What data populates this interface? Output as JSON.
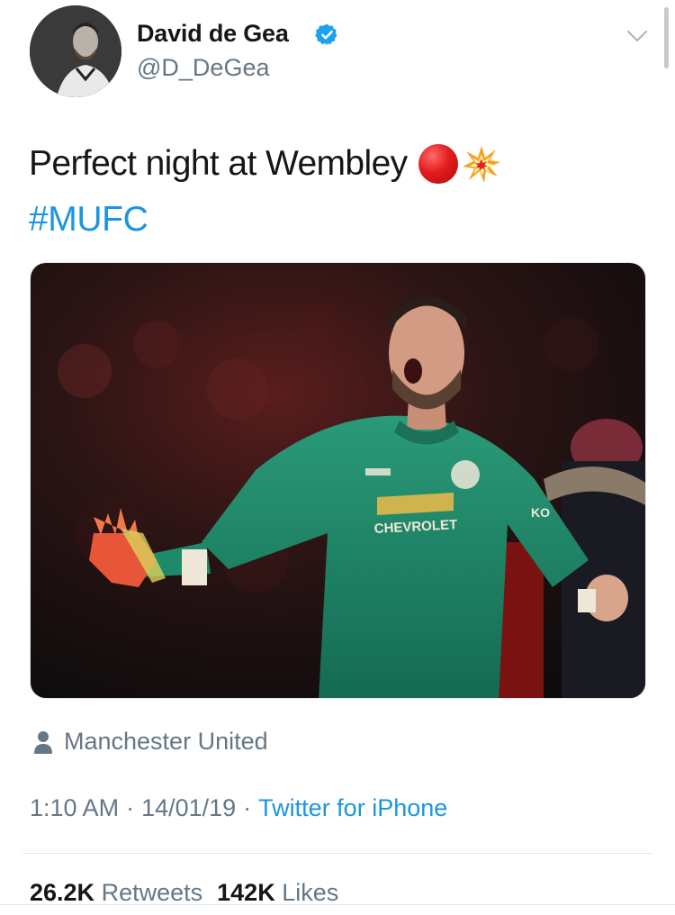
{
  "author": {
    "display_name": "David de Gea",
    "handle": "@D_DeGea",
    "verified": true,
    "avatar_icon": "profile-photo"
  },
  "tweet": {
    "text": "Perfect night at Wembley",
    "emojis": [
      "red-circle",
      "collision"
    ],
    "hashtag": "#MUFC"
  },
  "media": {
    "kind": "photo",
    "shirt_sponsor": "CHEVROLET",
    "sleeve_text": "KO"
  },
  "place": {
    "icon": "person-icon",
    "label": "Manchester United"
  },
  "meta": {
    "time": "1:10 AM",
    "date": "14/01/19",
    "separator": "·",
    "source": "Twitter for iPhone"
  },
  "stats": {
    "retweets_count": "26.2K",
    "retweets_label": "Retweets",
    "likes_count": "142K",
    "likes_label": "Likes"
  },
  "colors": {
    "link": "#1b95e0",
    "secondary_text": "#657786",
    "primary_text": "#14171a",
    "verified": "#1da1f2",
    "divider": "#e1e8ed"
  }
}
